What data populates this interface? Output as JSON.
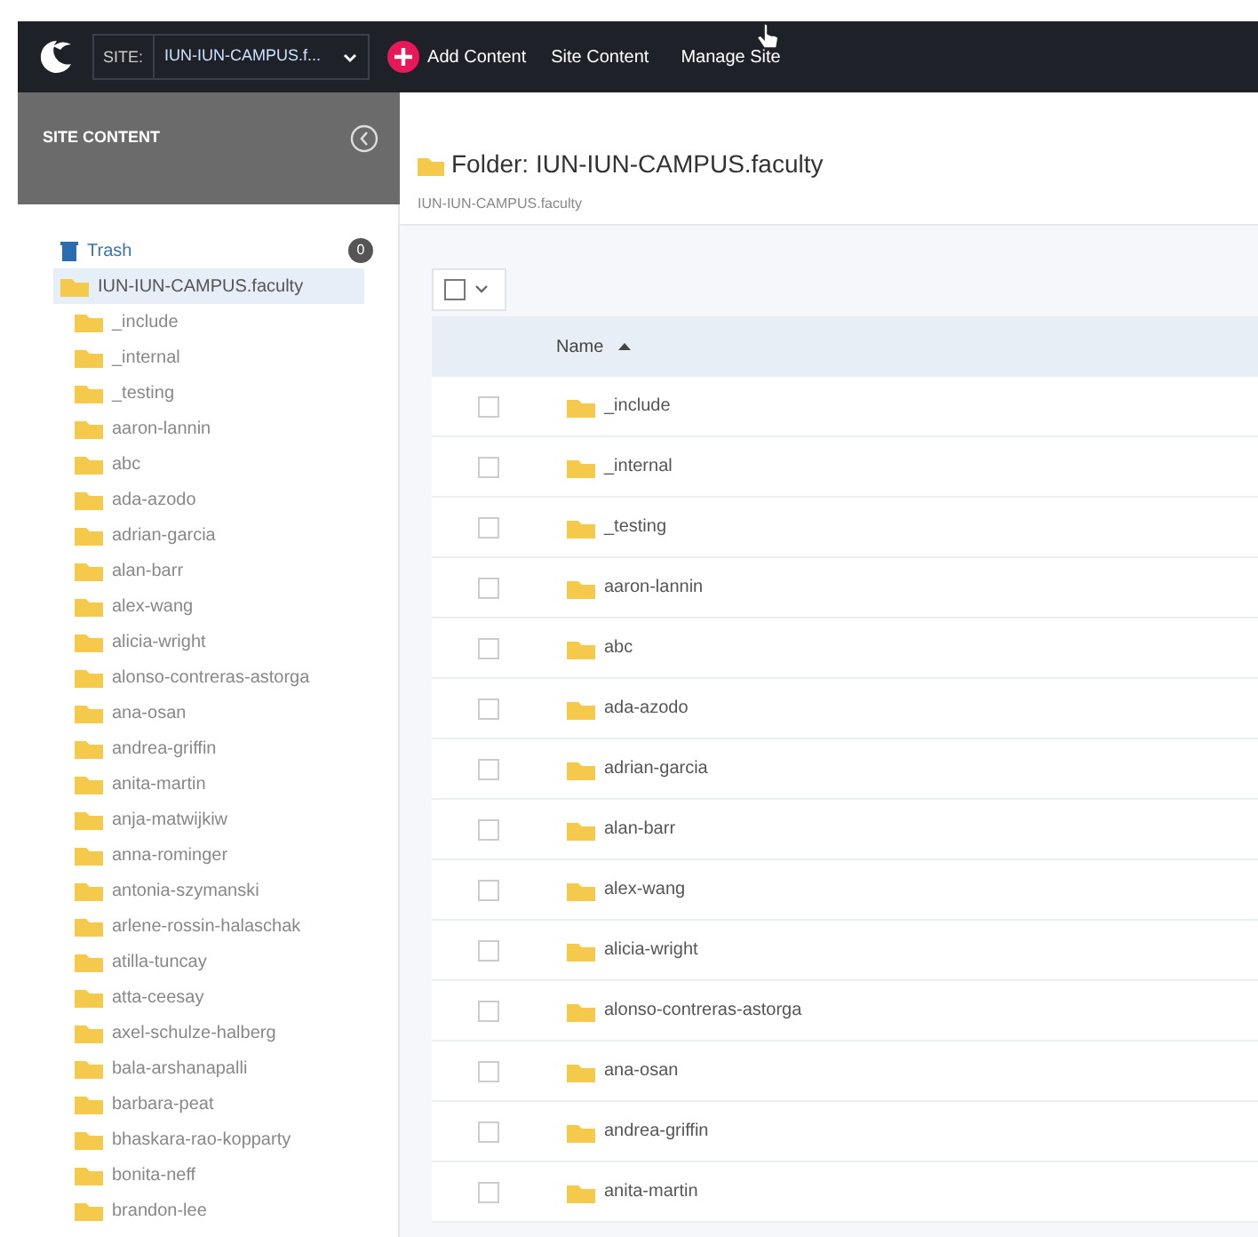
{
  "topbar": {
    "site_label": "SITE:",
    "site_value": "IUN-IUN-CAMPUS.f...",
    "add_button": "Add Content",
    "links": [
      "Site Content",
      "Manage Site"
    ]
  },
  "sidebar": {
    "title": "SITE CONTENT",
    "trash": {
      "label": "Trash",
      "count": "0"
    },
    "tree": [
      {
        "label": "IUN-IUN-CAMPUS.faculty",
        "selected": true,
        "children": [
          {
            "label": "_include",
            "selected": false
          },
          {
            "label": "_internal",
            "selected": false
          },
          {
            "label": "_testing",
            "selected": false
          },
          {
            "label": "aaron-lannin",
            "selected": false
          },
          {
            "label": "abc",
            "selected": false
          },
          {
            "label": "ada-azodo",
            "selected": false
          },
          {
            "label": "adrian-garcia",
            "selected": false
          },
          {
            "label": "alan-barr",
            "selected": false
          },
          {
            "label": "alex-wang",
            "selected": false
          },
          {
            "label": "alicia-wright",
            "selected": false
          },
          {
            "label": "alonso-contreras-astorga",
            "selected": false
          },
          {
            "label": "ana-osan",
            "selected": false
          },
          {
            "label": "andrea-griffin",
            "selected": false
          },
          {
            "label": "anita-martin",
            "selected": false
          },
          {
            "label": "anja-matwijkiw",
            "selected": false
          },
          {
            "label": "anna-rominger",
            "selected": false
          },
          {
            "label": "antonia-szymanski",
            "selected": false
          },
          {
            "label": "arlene-rossin-halaschak",
            "selected": false
          },
          {
            "label": "atilla-tuncay",
            "selected": false
          },
          {
            "label": "atta-ceesay",
            "selected": false
          },
          {
            "label": "axel-schulze-halberg",
            "selected": false
          },
          {
            "label": "bala-arshanapalli",
            "selected": false
          },
          {
            "label": "barbara-peat",
            "selected": false
          },
          {
            "label": "bhaskara-rao-kopparty",
            "selected": false
          },
          {
            "label": "bonita-neff",
            "selected": false
          },
          {
            "label": "brandon-lee",
            "selected": false
          }
        ]
      }
    ]
  },
  "main": {
    "title": "Folder: IUN-IUN-CAMPUS.faculty",
    "breadcrumb": "IUN-IUN-CAMPUS.faculty",
    "select_all": {
      "checked": false
    },
    "table": {
      "columns": [
        {
          "label": "Name",
          "sorted_ascending": true
        }
      ],
      "rows": [
        {
          "name": "_include",
          "checked": false
        },
        {
          "name": "_internal",
          "checked": false
        },
        {
          "name": "_testing",
          "checked": false
        },
        {
          "name": "aaron-lannin",
          "checked": false
        },
        {
          "name": "abc",
          "checked": false
        },
        {
          "name": "ada-azodo",
          "checked": false
        },
        {
          "name": "adrian-garcia",
          "checked": false
        },
        {
          "name": "alan-barr",
          "checked": false
        },
        {
          "name": "alex-wang",
          "checked": false
        },
        {
          "name": "alicia-wright",
          "checked": false
        },
        {
          "name": "alonso-contreras-astorga",
          "checked": false
        },
        {
          "name": "ana-osan",
          "checked": false
        },
        {
          "name": "andrea-griffin",
          "checked": false
        },
        {
          "name": "anita-martin",
          "checked": false
        }
      ]
    }
  }
}
